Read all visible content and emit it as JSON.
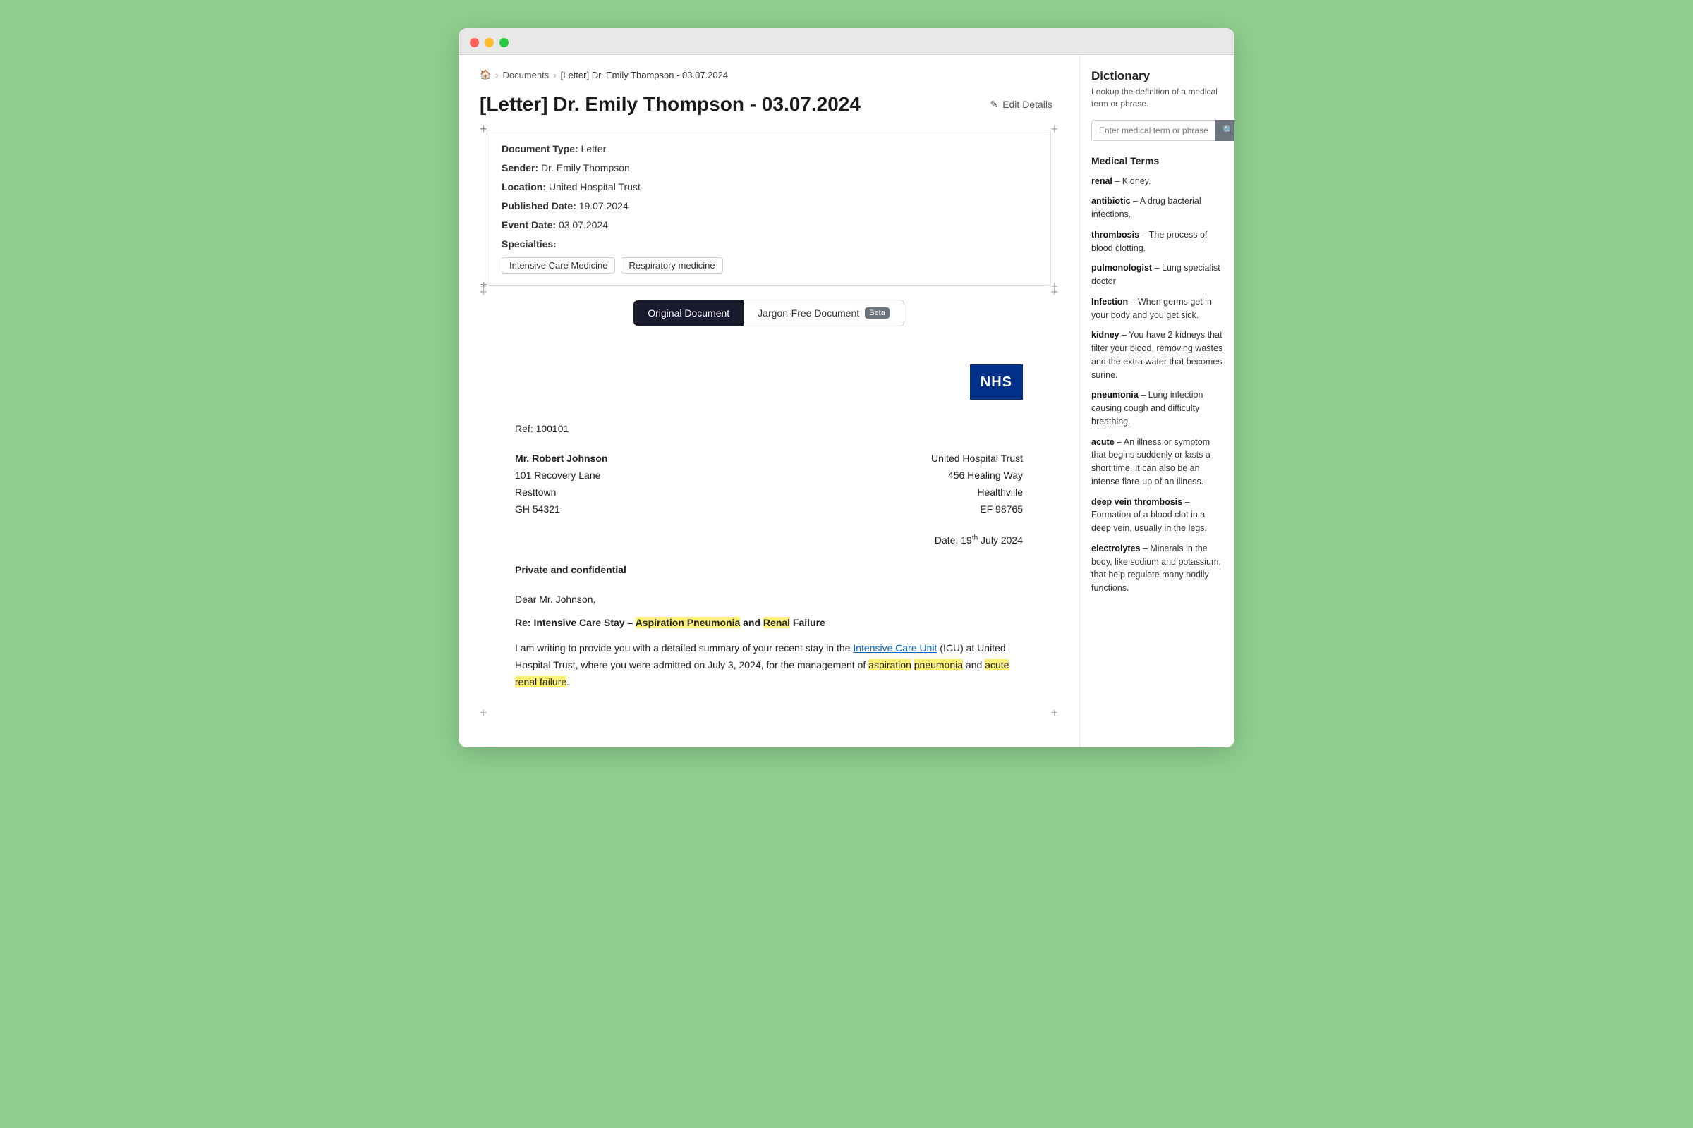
{
  "browser": {
    "traffic_lights": [
      "red",
      "yellow",
      "green"
    ]
  },
  "breadcrumb": {
    "home_icon": "🏠",
    "documents": "Documents",
    "current": "[Letter] Dr. Emily Thompson - 03.07.2024"
  },
  "page": {
    "title": "[Letter] Dr. Emily Thompson - 03.07.2024",
    "edit_button": "Edit Details"
  },
  "metadata": {
    "document_type_label": "Document Type:",
    "document_type_value": "Letter",
    "sender_label": "Sender:",
    "sender_value": "Dr. Emily Thompson",
    "location_label": "Location:",
    "location_value": "United Hospital Trust",
    "published_date_label": "Published Date:",
    "published_date_value": "19.07.2024",
    "event_date_label": "Event Date:",
    "event_date_value": "03.07.2024",
    "specialties_label": "Specialties:",
    "specialties": [
      "Intensive Care Medicine",
      "Respiratory medicine"
    ]
  },
  "tabs": {
    "original": "Original Document",
    "jargon_free": "Jargon-Free Document",
    "beta_label": "Beta"
  },
  "letter": {
    "nhs_logo": "NHS",
    "ref": "Ref: 100101",
    "patient_name": "Mr. Robert Johnson",
    "patient_address_1": "101 Recovery Lane",
    "patient_address_2": "Resttown",
    "patient_address_3": "GH 54321",
    "hospital_name": "United Hospital Trust",
    "hospital_address_1": "456 Healing Way",
    "hospital_address_2": "Healthville",
    "hospital_address_3": "EF 98765",
    "date": "Date: 19th July 2024",
    "confidential": "Private and confidential",
    "dear": "Dear Mr. Johnson,",
    "re_line": "Re: Intensive Care Stay – Aspiration Pneumonia and Renal Failure",
    "body_1": "I am writing to provide you with a detailed summary of your recent stay in the",
    "body_icu_link": "Intensive Care Unit",
    "body_2": " (ICU) at United Hospital Trust, where you were admitted on July 3, 2024, for the management of",
    "body_aspiration": "aspiration",
    "body_pneumonia": "pneumonia",
    "body_and": " and ",
    "body_acute": "acute",
    "body_renal": "renal failure",
    "body_end": "."
  },
  "sidebar": {
    "dictionary_title": "Dictionary",
    "dictionary_subtitle": "Lookup the definition of a medical term or phrase.",
    "search_placeholder": "Enter medical term or phrase",
    "search_btn_icon": "🔍",
    "medical_terms_title": "Medical Terms",
    "terms": [
      {
        "name": "renal",
        "definition": "Kidney."
      },
      {
        "name": "antibiotic",
        "definition": "A drug bacterial infections."
      },
      {
        "name": "thrombosis",
        "definition": "The process of blood clotting."
      },
      {
        "name": "pulmonologist",
        "definition": "Lung specialist doctor"
      },
      {
        "name": "Infection",
        "definition": "When germs get in your body and you get sick."
      },
      {
        "name": "kidney",
        "definition": "You have 2 kidneys that filter your blood, removing wastes and the extra water that becomes surine."
      },
      {
        "name": "pneumonia",
        "definition": "Lung infection causing cough and difficulty breathing."
      },
      {
        "name": "acute",
        "definition": "An illness or symptom that begins suddenly or lasts a short time. It can also be an intense flare-up of an illness."
      },
      {
        "name": "deep vein thrombosis",
        "definition": "Formation of a blood clot in a deep vein, usually in the legs."
      },
      {
        "name": "electrolytes",
        "definition": "Minerals in the body, like sodium and potassium, that help regulate many bodily functions."
      }
    ]
  }
}
